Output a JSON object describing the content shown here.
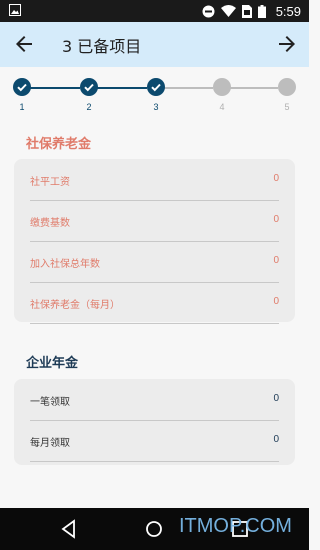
{
  "status_bar": {
    "time": "5:59",
    "icons": [
      "image-icon",
      "do-not-disturb-icon",
      "wifi-icon",
      "sim-icon",
      "battery-icon"
    ]
  },
  "app_bar": {
    "title": "3 已备项目",
    "icons": [
      "back-arrow-icon",
      "forward-arrow-icon"
    ]
  },
  "stepper": {
    "steps": [
      {
        "number": "1",
        "state": "done"
      },
      {
        "number": "2",
        "state": "done"
      },
      {
        "number": "3",
        "state": "current"
      },
      {
        "number": "4",
        "state": "todo"
      },
      {
        "number": "5",
        "state": "todo"
      }
    ],
    "colors": {
      "done": "#0c4a6e",
      "todo": "#bdbdbd"
    }
  },
  "pension": {
    "title": "社保养老金",
    "rows": [
      {
        "label": "社平工资",
        "value": "0"
      },
      {
        "label": "缴费基数",
        "value": "0"
      },
      {
        "label": "加入社保总年数",
        "value": "0"
      },
      {
        "label": "社保养老金（每月）",
        "value": "0"
      }
    ],
    "color": "#e07b6a"
  },
  "annuity": {
    "title": "企业年金",
    "rows": [
      {
        "label": "一笔领取",
        "value": "0"
      },
      {
        "label": "每月领取",
        "value": "0"
      }
    ],
    "color": "#1d3a55"
  },
  "nav_bar": {
    "icons": [
      "back-triangle-icon",
      "home-circle-icon",
      "recents-square-icon"
    ]
  },
  "watermark": {
    "text": "ITMOP.COM"
  }
}
